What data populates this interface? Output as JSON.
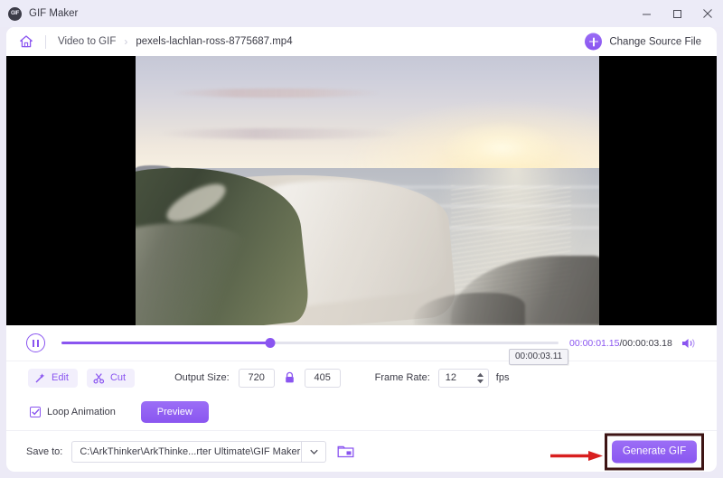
{
  "window": {
    "title": "GIF Maker",
    "app_icon": "gif-circle-icon",
    "minimize": "minimize-icon",
    "maximize": "maximize-icon",
    "close": "close-icon"
  },
  "breadcrumb": {
    "home_icon": "home-icon",
    "section": "Video to GIF",
    "separator": "›",
    "file": "pexels-lachlan-ross-8775687.mp4"
  },
  "header": {
    "change_source_label": "Change Source File",
    "change_source_icon": "plus-circle-icon"
  },
  "player": {
    "pause_icon": "pause-icon",
    "current_time": "00:00:01.15",
    "separator": "/",
    "total_time": "00:00:03.18",
    "volume_icon": "volume-icon",
    "progress_percent": 42,
    "tooltip_time": "00:00:03.11"
  },
  "options": {
    "edit_label": "Edit",
    "edit_icon": "magic-wand-icon",
    "cut_label": "Cut",
    "cut_icon": "scissors-icon",
    "output_size_label": "Output Size:",
    "width_value": "720",
    "lock_icon": "lock-icon",
    "height_value": "405",
    "frame_rate_label": "Frame Rate:",
    "frame_rate_value": "12",
    "fps_unit": "fps",
    "spinner_icon": "spinner-arrows-icon"
  },
  "loop": {
    "checkbox_icon": "checkmark-icon",
    "checked": true,
    "label": "Loop Animation",
    "preview_label": "Preview"
  },
  "save": {
    "label": "Save to:",
    "path": "C:\\ArkThinker\\ArkThinke...rter Ultimate\\GIF Maker",
    "dropdown_icon": "chevron-down-icon",
    "folder_icon": "folder-open-icon",
    "generate_label": "Generate GIF",
    "annotation_icon": "red-arrow-icon"
  },
  "colors": {
    "accent": "#8a55f0",
    "accent_light": "#f2effc",
    "title_bg": "#ecebf7",
    "panel_bg": "#ffffff",
    "text": "#3b3b46",
    "annotation_red": "#d81f1f",
    "annotation_border": "#3d1414"
  },
  "video_preview": {
    "description": "Aerial coastal sunset over ocean with curving sandy beach"
  }
}
